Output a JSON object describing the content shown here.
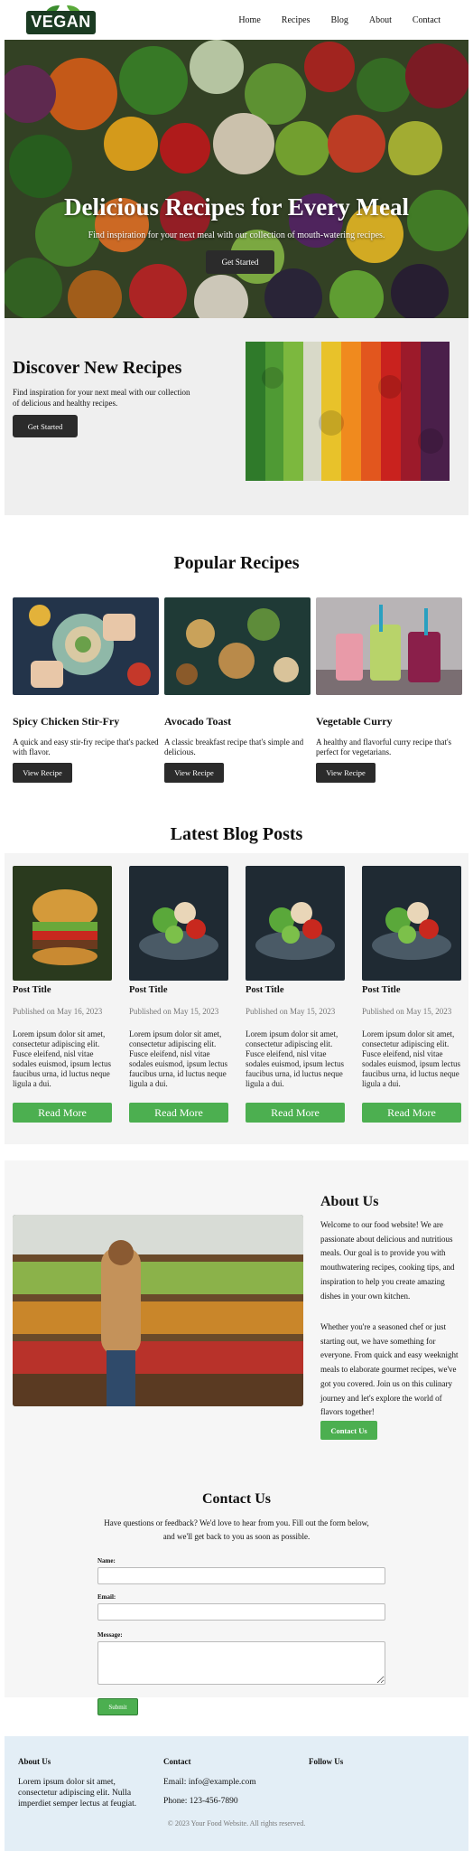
{
  "header": {
    "logo_text": "VEGAN",
    "nav": [
      "Home",
      "Recipes",
      "Blog",
      "About",
      "Contact"
    ]
  },
  "hero": {
    "title": "Delicious Recipes for Every Meal",
    "subtitle": "Find inspiration for your next meal with our collection of mouth-watering recipes.",
    "button": "Get Started"
  },
  "discover": {
    "title": "Discover New Recipes",
    "text": "Find inspiration for your next meal with our collection of delicious and healthy recipes.",
    "button": "Get Started"
  },
  "popular": {
    "title": "Popular Recipes",
    "recipes": [
      {
        "name": "Spicy Chicken Stir-Fry",
        "desc": "A quick and easy stir-fry recipe that's packed with flavor.",
        "button": "View Recipe"
      },
      {
        "name": "Avocado Toast",
        "desc": "A classic breakfast recipe that's simple and delicious.",
        "button": "View Recipe"
      },
      {
        "name": "Vegetable Curry",
        "desc": "A healthy and flavorful curry recipe that's perfect for vegetarians.",
        "button": "View Recipe"
      }
    ]
  },
  "blog": {
    "title": "Latest Blog Posts",
    "posts": [
      {
        "title": "Post Title",
        "date": "Published on May 16, 2023",
        "body": "Lorem ipsum dolor sit amet, consectetur adipiscing elit. Fusce eleifend, nisl vitae sodales euismod, ipsum lectus faucibus urna, id luctus neque ligula a dui.",
        "button": "Read More"
      },
      {
        "title": "Post Title",
        "date": "Published on May 15, 2023",
        "body": "Lorem ipsum dolor sit amet, consectetur adipiscing elit. Fusce eleifend, nisl vitae sodales euismod, ipsum lectus faucibus urna, id luctus neque ligula a dui.",
        "button": "Read More"
      },
      {
        "title": "Post Title",
        "date": "Published on May 15, 2023",
        "body": "Lorem ipsum dolor sit amet, consectetur adipiscing elit. Fusce eleifend, nisl vitae sodales euismod, ipsum lectus faucibus urna, id luctus neque ligula a dui.",
        "button": "Read More"
      },
      {
        "title": "Post Title",
        "date": "Published on May 15, 2023",
        "body": "Lorem ipsum dolor sit amet, consectetur adipiscing elit. Fusce eleifend, nisl vitae sodales euismod, ipsum lectus faucibus urna, id luctus neque ligula a dui.",
        "button": "Read More"
      }
    ]
  },
  "about": {
    "title": "About Us",
    "p1": "Welcome to our food website! We are passionate about delicious and nutritious meals. Our goal is to provide you with mouthwatering recipes, cooking tips, and inspiration to help you create amazing dishes in your own kitchen.",
    "p2": "Whether you're a seasoned chef or just starting out, we have something for everyone. From quick and easy weeknight meals to elaborate gourmet recipes, we've got you covered. Join us on this culinary journey and let's explore the world of flavors together!",
    "button": "Contact Us"
  },
  "contact": {
    "title": "Contact Us",
    "text": "Have questions or feedback? We'd love to hear from you. Fill out the form below, and we'll get back to you as soon as possible.",
    "name_label": "Name:",
    "email_label": "Email:",
    "message_label": "Message:",
    "name_value": "",
    "email_value": "",
    "message_value": "",
    "submit": "Submit"
  },
  "footer": {
    "about_heading": "About Us",
    "about_text": "Lorem ipsum dolor sit amet, consectetur adipiscing elit. Nulla imperdiet semper lectus at feugiat.",
    "contact_heading": "Contact",
    "email": "Email: info@example.com",
    "phone": "Phone: 123-456-7890",
    "follow_heading": "Follow Us",
    "copyright": "© 2023 Your Food Website. All rights reserved."
  },
  "colors": {
    "accent_green": "#4caf50",
    "dark_button": "#2b2b2b",
    "logo_green": "#1b3b22",
    "footer_bg": "#e3eef6"
  }
}
